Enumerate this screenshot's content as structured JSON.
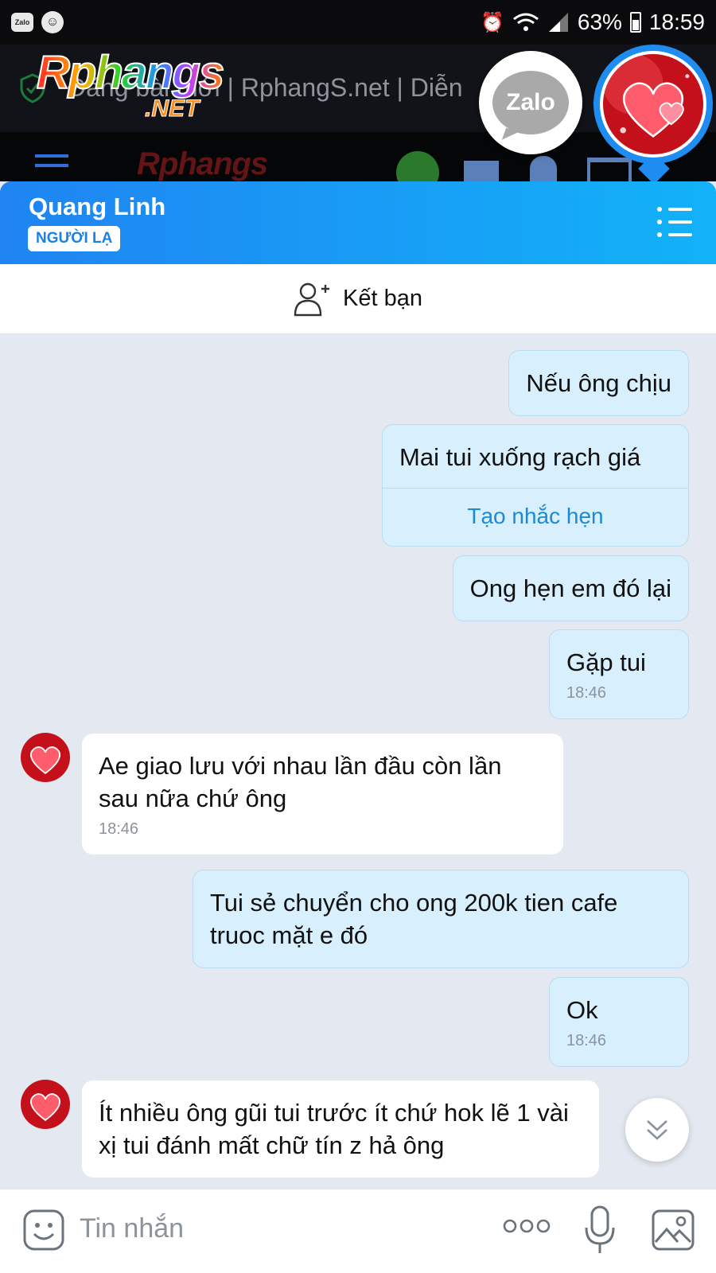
{
  "status_bar": {
    "battery": "63%",
    "time": "18:59"
  },
  "background_page": {
    "title": "Đăng bài mới | RphangS.net | Diễn",
    "logo_main": "Rphangs",
    "logo_sub": ".NET",
    "nav_logo": "Rphangs"
  },
  "chat_head": {
    "zalo_label": "Zalo"
  },
  "chat": {
    "contact_name": "Quang Linh",
    "badge": "NGƯỜI LẠ",
    "add_friend_label": "Kết bạn",
    "messages": [
      {
        "side": "out",
        "text": "Nếu ông chịu"
      },
      {
        "side": "out",
        "text": "Mai tui xuống rạch giá",
        "action": "Tạo nhắc hẹn"
      },
      {
        "side": "out",
        "text": "Ong hẹn em đó lại"
      },
      {
        "side": "out",
        "text": "Gặp tui",
        "time": "18:46"
      },
      {
        "side": "in",
        "text": "Ae giao lưu với nhau lần đầu còn lần sau nữa chứ ông",
        "time": "18:46"
      },
      {
        "side": "out",
        "text": "Tui sẻ chuyển cho ong 200k tien cafe truoc mặt e đó"
      },
      {
        "side": "out",
        "text": "Ok",
        "time": "18:46"
      },
      {
        "side": "in",
        "text": "Ít nhiều ông gũi tui trước ít chứ hok lẽ 1 vài xị tui đánh mất chữ tín z hả ông"
      }
    ]
  },
  "input": {
    "placeholder": "Tin nhắn"
  },
  "colors": {
    "header_gradient_start": "#1f84f2",
    "header_gradient_end": "#12b2f8",
    "outgoing_bubble": "#d8effd",
    "incoming_bubble": "#ffffff",
    "chat_background": "#e4e8f0",
    "link": "#1a8ad8"
  },
  "icons": [
    "zalo-app-icon",
    "notification-face-icon",
    "alarm-icon",
    "wifi-icon",
    "signal-icon",
    "battery-icon",
    "shield-icon",
    "list-menu-icon",
    "add-friend-icon",
    "scroll-down-icon",
    "emoji-icon",
    "more-icon",
    "microphone-icon",
    "image-icon"
  ]
}
